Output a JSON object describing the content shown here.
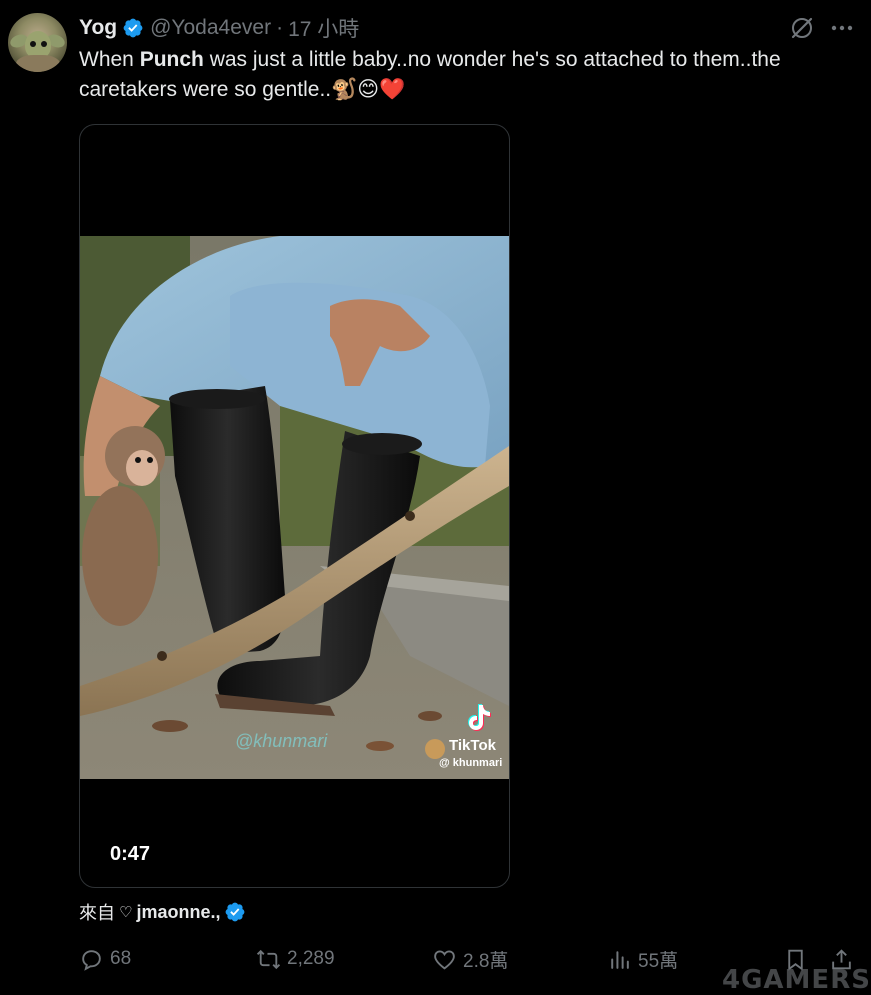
{
  "tweet": {
    "author_name": "Yog",
    "handle": "@Yoda4ever",
    "separator": "·",
    "time": "17 小時",
    "text_part1": "When ",
    "text_bold": "Punch",
    "text_part2": " was just a little baby..no wonder he's so attached to them..the caretakers were so gentle..",
    "emojis": "🐒😊❤️"
  },
  "media": {
    "duration": "0:47",
    "watermark_text": "@khunmari",
    "tiktok_label": "TikTok",
    "tiktok_handle": "@ khunmari"
  },
  "source": {
    "label": "來自",
    "heart": "♡",
    "user": "jmaonne.,"
  },
  "actions": {
    "replies": "68",
    "reposts": "2,289",
    "likes": "2.8萬",
    "views": "55萬"
  },
  "watermark": "4GAMERS",
  "colors": {
    "background": "#000000",
    "text": "#e7e9ea",
    "muted": "#71767b",
    "verified": "#1d9bf0"
  }
}
